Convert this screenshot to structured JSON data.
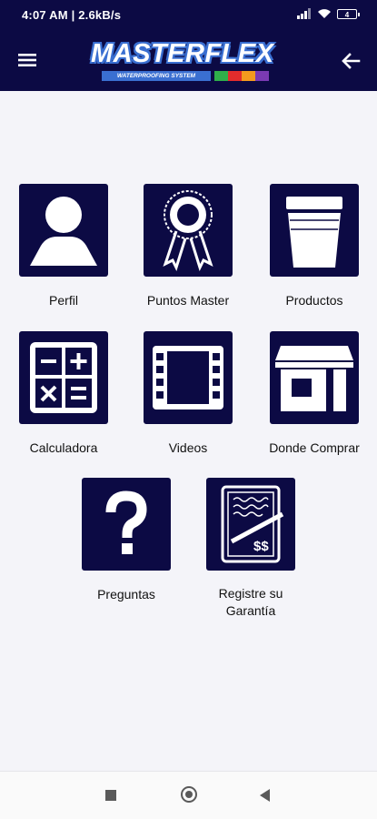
{
  "status_bar": {
    "time": "4:07 AM | 2.6kB/s",
    "battery": "4"
  },
  "header": {
    "logo_title": "MASTERFLEX",
    "logo_subtitle": "WATERPROOFING SYSTEM",
    "logo_stripe_colors": [
      "#2fae4a",
      "#e32c2c",
      "#f39a1e",
      "#7a3ab3"
    ]
  },
  "menu": [
    {
      "label": "Perfil",
      "icon": "profile-icon"
    },
    {
      "label": "Puntos Master",
      "icon": "ribbon-award-icon"
    },
    {
      "label": "Productos",
      "icon": "bucket-icon"
    },
    {
      "label": "Calculadora",
      "icon": "calculator-icon"
    },
    {
      "label": "Videos",
      "icon": "film-strip-icon"
    },
    {
      "label": "Donde Comprar",
      "icon": "store-icon"
    },
    {
      "label": "Preguntas",
      "icon": "question-mark-icon"
    },
    {
      "label": "Registre su\nGarantía",
      "icon": "warranty-document-icon"
    }
  ],
  "colors": {
    "primary": "#0c0a44",
    "background": "#f4f4f9",
    "logo_blue": "#3a6fd1"
  }
}
